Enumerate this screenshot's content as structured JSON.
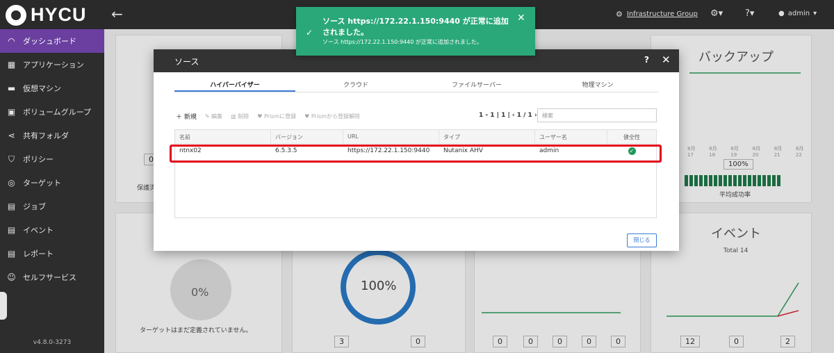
{
  "app": {
    "logo": "HYCU",
    "back_icon": "arrow-left-icon"
  },
  "topbar": {
    "infra_label": "Infrastructure Group",
    "user_label": "admin"
  },
  "sidebar": {
    "items": [
      {
        "label": "ダッシュボード",
        "icon": "dashboard-icon",
        "active": true
      },
      {
        "label": "アプリケーション",
        "icon": "apps-icon"
      },
      {
        "label": "仮想マシン",
        "icon": "vm-icon"
      },
      {
        "label": "ボリュームグループ",
        "icon": "volume-icon"
      },
      {
        "label": "共有フォルダ",
        "icon": "share-icon"
      },
      {
        "label": "ポリシー",
        "icon": "shield-icon"
      },
      {
        "label": "ターゲット",
        "icon": "target-icon"
      },
      {
        "label": "ジョブ",
        "icon": "job-icon"
      },
      {
        "label": "イベント",
        "icon": "event-icon"
      },
      {
        "label": "レポート",
        "icon": "report-icon"
      },
      {
        "label": "セルフサービス",
        "icon": "self-service-icon"
      }
    ],
    "version": "v4.8.0-3273"
  },
  "background": {
    "backup_title": "バックアップ",
    "backup_percent": "100%",
    "backup_caption": "平均成功率",
    "backup_dates": [
      "8月 17",
      "8月 18",
      "8月 19",
      "8月 20",
      "8月 21",
      "8月 22"
    ],
    "events_title": "イベント",
    "events_total": "Total 14",
    "events_counts": [
      "12",
      "0",
      "2"
    ],
    "targets_percent": "0%",
    "targets_message": "ターゲットはまだ定義されていません。",
    "compliance_percent": "100%",
    "compliance_counts": [
      "3",
      "0"
    ],
    "jobs_counts": [
      "0",
      "0",
      "0",
      "0",
      "0"
    ],
    "left_card_count": "0",
    "left_card_label": "保護済"
  },
  "modal": {
    "title": "ソース",
    "help": "?",
    "tabs": [
      "ハイパーバイザー",
      "クラウド",
      "ファイルサーバー",
      "物理マシン"
    ],
    "toolbar": {
      "new": "新規",
      "edit": "編集",
      "delete": "削除",
      "register": "Prismに登録",
      "unregister": "Prismから登録解除"
    },
    "pager": "1 - 1 | 1 | ‹ 1 / 1 ›",
    "search_placeholder": "検索",
    "columns": [
      "名前",
      "バージョン",
      "URL",
      "タイプ",
      "ユーザー名",
      "健全性"
    ],
    "rows": [
      {
        "name": "ntnx02",
        "version": "6.5.3.5",
        "url": "https://172.22.1.150:9440",
        "type": "Nutanix AHV",
        "user": "admin",
        "health": "ok"
      }
    ],
    "close_label": "閉じる"
  },
  "toast": {
    "title": "ソース https://172.22.1.150:9440 が正常に追加されました。",
    "detail": "ソース https://172.22.1.150:9440 が正常に追加されました。"
  }
}
